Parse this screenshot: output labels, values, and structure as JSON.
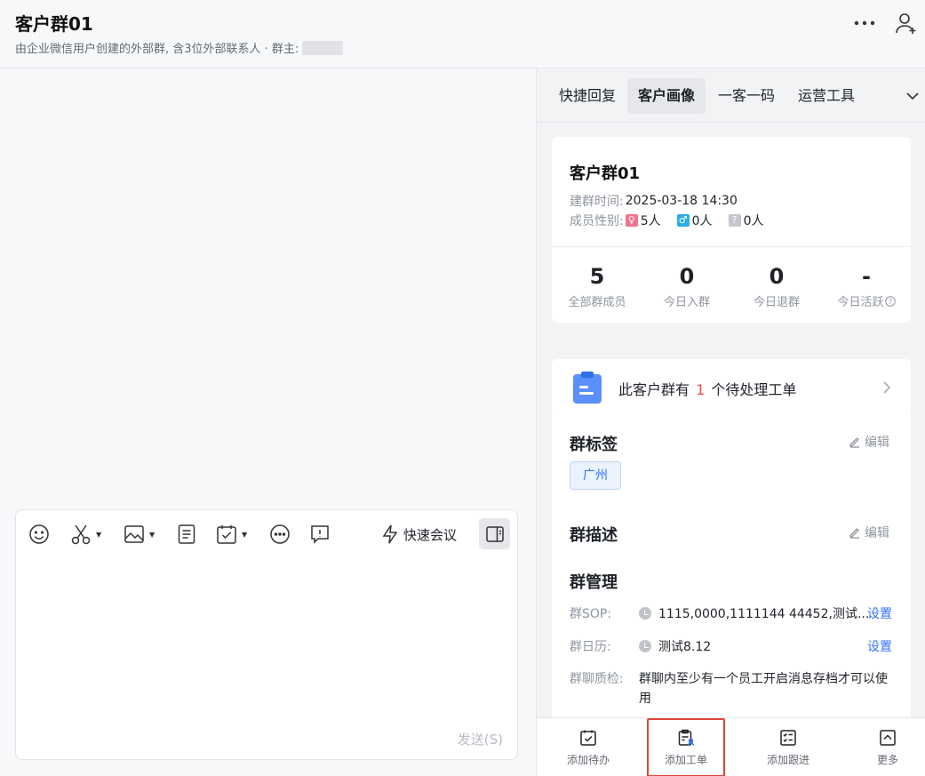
{
  "header": {
    "title": "客户群01",
    "subtitle": "由企业微信用户创建的外部群, 含3位外部联系人 · 群主:",
    "more_icon": "more-horizontal-icon",
    "add_member_icon": "add-user-icon"
  },
  "composer": {
    "toolbar": {
      "emoji_icon": "smile-icon",
      "screenshot_icon": "scissors-icon",
      "image_icon": "image-icon",
      "file_icon": "document-icon",
      "schedule_icon": "calendar-check-icon",
      "more_icon": "more-circle-icon",
      "chat_icon": "message-icon",
      "quick_meeting_label": "快速会议",
      "panel_toggle_icon": "sidebar-toggle-icon"
    },
    "send_label": "发送(S)"
  },
  "right_panel": {
    "tabs": [
      {
        "label": "快捷回复",
        "active": false
      },
      {
        "label": "客户画像",
        "active": true
      },
      {
        "label": "一客一码",
        "active": false
      },
      {
        "label": "运营工具",
        "active": false
      }
    ],
    "info": {
      "name": "客户群01",
      "created_label": "建群时间:",
      "created_value": "2025-03-18 14:30",
      "gender_label": "成员性别:",
      "female": "5人",
      "male": "0人",
      "unknown": "0人"
    },
    "stats": [
      {
        "num": "5",
        "label": "全部群成员"
      },
      {
        "num": "0",
        "label": "今日入群"
      },
      {
        "num": "0",
        "label": "今日退群"
      },
      {
        "num": "-",
        "label": "今日活跃"
      }
    ],
    "ticket": {
      "prefix": "此客户群有",
      "count": "1",
      "suffix": "个待处理工单"
    },
    "tags": {
      "title": "群标签",
      "edit": "编辑",
      "items": [
        "广州"
      ]
    },
    "description": {
      "title": "群描述",
      "edit": "编辑"
    },
    "management": {
      "title": "群管理",
      "sop_label": "群SOP:",
      "sop_value": "1115,0000,1111144 44452,测试...",
      "sop_action": "设置",
      "calendar_label": "群日历:",
      "calendar_value": "测试8.12",
      "calendar_action": "设置",
      "qc_label": "群聊质检:",
      "qc_value": "群聊内至少有一个员工开启消息存档才可以使用"
    },
    "bottom_bar": [
      {
        "label": "添加待办",
        "icon": "todo-icon"
      },
      {
        "label": "添加工单",
        "icon": "ticket-icon",
        "highlighted": true
      },
      {
        "label": "添加跟进",
        "icon": "followup-icon"
      },
      {
        "label": "更多",
        "icon": "more-up-icon"
      }
    ]
  },
  "colors": {
    "accent": "#3370ff",
    "female": "#f2738c",
    "male": "#2aaee8",
    "unknown": "#c3c6cc",
    "highlight_border": "#e0463b",
    "count_red": "#f54a45"
  }
}
